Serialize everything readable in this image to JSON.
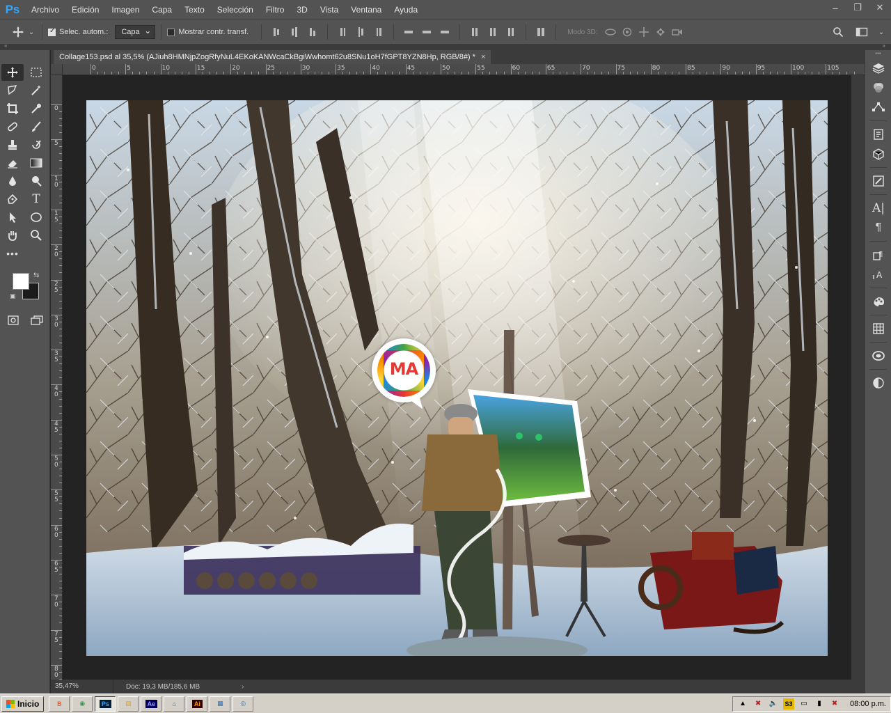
{
  "app": {
    "logo": "Ps",
    "menu": [
      "Archivo",
      "Edición",
      "Imagen",
      "Capa",
      "Texto",
      "Selección",
      "Filtro",
      "3D",
      "Vista",
      "Ventana",
      "Ayuda"
    ]
  },
  "window_controls": {
    "minimize": "–",
    "restore": "❐",
    "close": "✕"
  },
  "options": {
    "auto_select_label": "Selec. autom.:",
    "auto_select_checked": true,
    "auto_select_target": "Capa",
    "show_transform_label": "Mostrar contr. transf.",
    "show_transform_checked": false,
    "mode_3d_label": "Modo 3D:"
  },
  "document": {
    "tab_title": "Collage153.psd al 35,5% (AJiuh8HMNjpZogRfyNuL4EKoKANWcaCkBgiWwhomt62u8SNu1oH7fGPT8YZN8Hp, RGB/8#) *",
    "tab_close": "×"
  },
  "rulers": {
    "horizontal_labels": [
      "0",
      "5",
      "10",
      "15",
      "20",
      "25",
      "30",
      "35",
      "40",
      "45",
      "50",
      "55",
      "60",
      "65",
      "70",
      "75",
      "80",
      "85",
      "90",
      "95",
      "100",
      "105"
    ],
    "vertical_labels": [
      "0",
      "5",
      "1 0",
      "1 5",
      "2 0",
      "2 5",
      "3 0",
      "3 5",
      "4 0",
      "4 5",
      "5 0",
      "5 5",
      "6 0",
      "6 5",
      "7 0",
      "7 5",
      "8 0"
    ]
  },
  "status": {
    "zoom": "35,47%",
    "doc_size": "Doc: 19,3 MB/185,6 MB",
    "arrow": "›"
  },
  "artwork": {
    "logo_text": "MA",
    "description_colors": {
      "snow": "#e8f0f8",
      "bark": "#3a3026",
      "jacket": "#8a6a3a",
      "sled": "#7a1818"
    }
  },
  "taskbar": {
    "start_label": "Inicio",
    "apps": [
      {
        "name": "brave",
        "label": "B",
        "color": "#fb542b"
      },
      {
        "name": "chrome",
        "label": "◉",
        "color": "#2a9d4a"
      },
      {
        "name": "photoshop",
        "label": "Ps",
        "color": "#31a8ff"
      },
      {
        "name": "explorer",
        "label": "▤",
        "color": "#d9a520"
      },
      {
        "name": "after-effects",
        "label": "Ae",
        "color": "#9999ff"
      },
      {
        "name": "app-blue",
        "label": "⌂",
        "color": "#1e6fc2"
      },
      {
        "name": "illustrator",
        "label": "Ai",
        "color": "#ff9a00"
      },
      {
        "name": "notepad",
        "label": "▦",
        "color": "#2c6fb2"
      },
      {
        "name": "disk-tool",
        "label": "◎",
        "color": "#3a7ac9"
      }
    ],
    "tray_badge": "S3",
    "clock": "08:00 p.m."
  }
}
